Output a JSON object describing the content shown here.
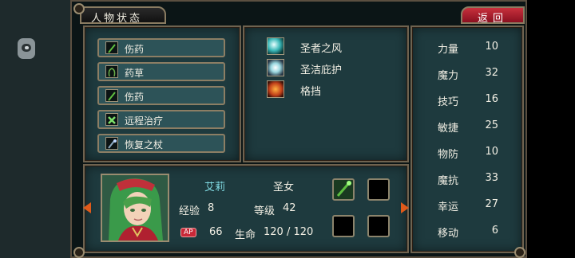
{
  "header": {
    "title": "人物状态",
    "back_label": "返回"
  },
  "items": [
    {
      "label": "伤药",
      "icon": "wand-icon"
    },
    {
      "label": "药草",
      "icon": "herb-icon"
    },
    {
      "label": "伤药",
      "icon": "wand-icon"
    },
    {
      "label": "远程治疗",
      "icon": "heal-cross-icon"
    },
    {
      "label": "恢复之杖",
      "icon": "staff-icon"
    }
  ],
  "skills": [
    {
      "name": "圣者之风",
      "icon": "wind-icon"
    },
    {
      "name": "圣洁庇护",
      "icon": "shield-aura-icon"
    },
    {
      "name": "格挡",
      "icon": "block-icon"
    }
  ],
  "stats": [
    {
      "label": "力量",
      "value": "10"
    },
    {
      "label": "魔力",
      "value": "32"
    },
    {
      "label": "技巧",
      "value": "16"
    },
    {
      "label": "敏捷",
      "value": "25"
    },
    {
      "label": "物防",
      "value": "10"
    },
    {
      "label": "魔抗",
      "value": "33"
    },
    {
      "label": "幸运",
      "value": "27"
    },
    {
      "label": "移动",
      "value": "6"
    }
  ],
  "character": {
    "name": "艾莉",
    "class": "圣女",
    "exp_label": "经验",
    "exp": "8",
    "level_label": "等级",
    "level": "42",
    "ap_badge": "AP",
    "ap": "66",
    "hp_label": "生命",
    "hp": "120 / 120"
  },
  "colors": {
    "accent_red": "#c8303c",
    "panel": "#1e3a3e",
    "name": "#7fd8e0"
  }
}
